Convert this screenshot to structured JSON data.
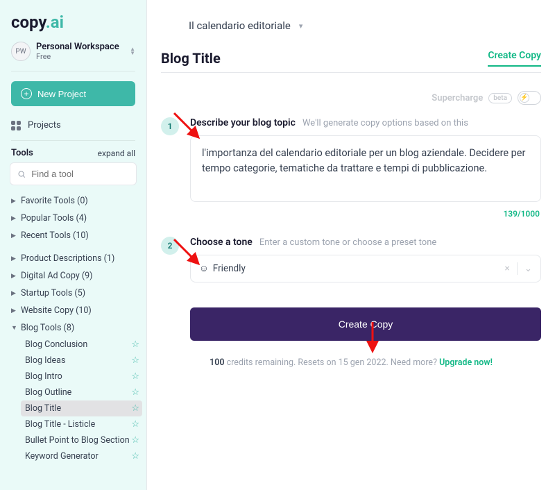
{
  "logo": {
    "text1": "copy",
    "text2": ".ai"
  },
  "workspace": {
    "avatar": "PW",
    "name": "Personal Workspace",
    "plan": "Free"
  },
  "sidebar": {
    "new_project": "New Project",
    "projects": "Projects",
    "tools_label": "Tools",
    "expand_all": "expand all",
    "search_placeholder": "Find a tool",
    "groups": [
      {
        "label": "Favorite Tools (0)",
        "open": false
      },
      {
        "label": "Popular Tools (4)",
        "open": false
      },
      {
        "label": "Recent Tools (10)",
        "open": false
      },
      {
        "label": "Product Descriptions (1)",
        "open": false
      },
      {
        "label": "Digital Ad Copy (9)",
        "open": false
      },
      {
        "label": "Startup Tools (5)",
        "open": false
      },
      {
        "label": "Website Copy (10)",
        "open": false
      },
      {
        "label": "Blog Tools (8)",
        "open": true,
        "items": [
          "Blog Conclusion",
          "Blog Ideas",
          "Blog Intro",
          "Blog Outline",
          "Blog Title",
          "Blog Title - Listicle",
          "Bullet Point to Blog Section",
          "Keyword Generator"
        ],
        "active_index": 4
      }
    ]
  },
  "breadcrumb": "Il calendario editoriale",
  "page_title": "Blog Title",
  "create_tab": "Create Copy",
  "supercharge": {
    "label": "Supercharge",
    "beta": "beta"
  },
  "step1": {
    "num": "1",
    "title": "Describe your blog topic",
    "hint": "We'll generate copy options based on this",
    "value": "l'importanza del calendario editoriale per un blog aziendale. Decidere per tempo categorie, tematiche da trattare e tempi di pubblicazione.",
    "char_count": "139/1000"
  },
  "step2": {
    "num": "2",
    "title": "Choose a tone",
    "hint": "Enter a custom tone or choose a preset tone",
    "value": "Friendly"
  },
  "create_button": "Create Copy",
  "credits": {
    "num": "100",
    "text": " credits remaining. Resets on 15 gen 2022. Need more?  ",
    "upgrade": "Upgrade now!"
  }
}
